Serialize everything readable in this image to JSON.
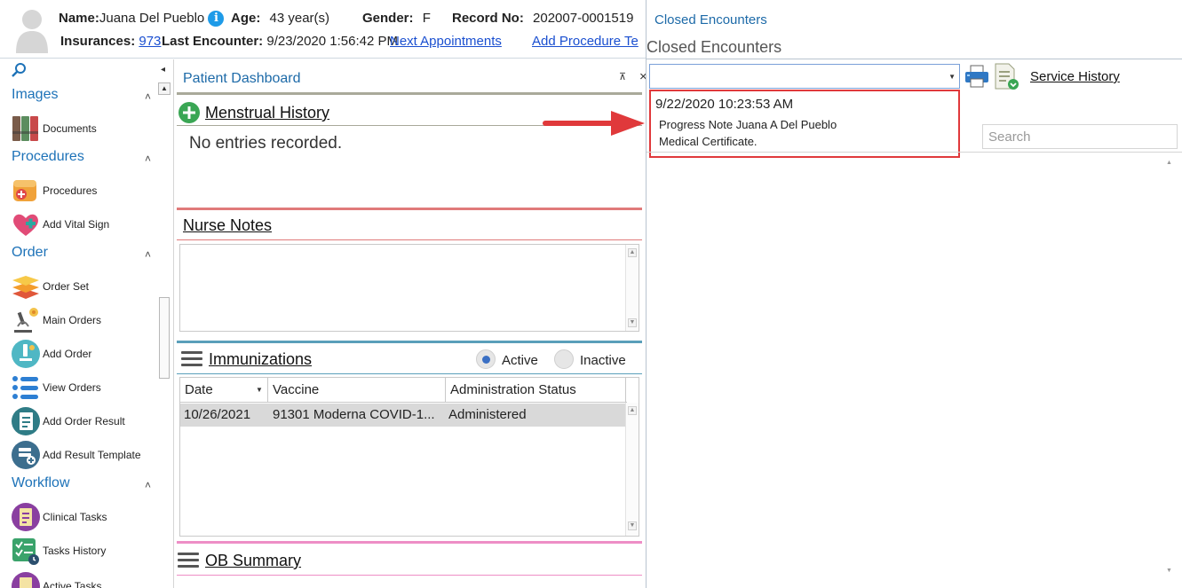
{
  "header": {
    "name_label": "Name:",
    "name_value": "Juana Del Pueblo",
    "info_glyph": "i",
    "age_label": "Age:",
    "age_value": "43 year(s)",
    "gender_label": "Gender:",
    "gender_value": "F",
    "record_label": "Record No:",
    "record_value": "202007-0001519",
    "insurances_label": "Insurances:",
    "insurances_value": "973",
    "last_encounter_label": "Last Encounter:",
    "last_encounter_value": "9/23/2020 1:56:42 PM",
    "next_appointments": "Next Appointments",
    "add_procedure": "Add Procedure Te"
  },
  "sidebar": {
    "collapse_glyph": "◂",
    "scroll_up": "▲",
    "scroll_down": "▼",
    "sections": {
      "images": "Images",
      "procedures": "Procedures",
      "order": "Order",
      "workflow": "Workflow"
    },
    "chevron": "˄",
    "items": {
      "documents": "Documents",
      "procedures": "Procedures",
      "add_vital_sign": "Add Vital Sign",
      "order_set": "Order Set",
      "main_orders": "Main Orders",
      "add_order": "Add Order",
      "view_orders": "View Orders",
      "add_order_result": "Add Order Result",
      "add_result_template": "Add Result Template",
      "clinical_tasks": "Clinical Tasks",
      "tasks_history": "Tasks History",
      "active_tasks": "Active Tasks"
    }
  },
  "dashboard": {
    "title": "Patient Dashboard",
    "pin_glyph": "⊼",
    "close_glyph": "×",
    "menstrual": {
      "title": "Menstrual History",
      "empty": "No entries recorded."
    },
    "nurse_notes": {
      "title": "Nurse Notes"
    },
    "immunizations": {
      "title": "Immunizations",
      "active_label": "Active",
      "inactive_label": "Inactive",
      "columns": [
        "Date",
        "Vaccine",
        "Administration Status"
      ],
      "rows": [
        {
          "date": "10/26/2021",
          "vaccine": "91301 Moderna COVID-1...",
          "status": "Administered"
        }
      ]
    },
    "ob_summary": {
      "title": "OB Summary"
    }
  },
  "closed_encounters": {
    "tab_title": "Closed Encounters",
    "heading": "Closed Encounters",
    "service_history": "Service History",
    "search_placeholder": "Search",
    "dropdown_item": {
      "datetime": "9/22/2020 10:23:53 AM",
      "line1": "Progress Note  Juana A Del Pueblo",
      "line2": "Medical Certificate."
    }
  },
  "colors": {
    "accent_blue": "#1d72b8",
    "link_blue": "#1a4fd0",
    "highlight_red": "#e0393b",
    "menstrual_rule": "#a9a99a",
    "nurse_rule": "#e07a7a",
    "immun_rule": "#5a9fba",
    "ob_rule": "#ee8ec6"
  }
}
